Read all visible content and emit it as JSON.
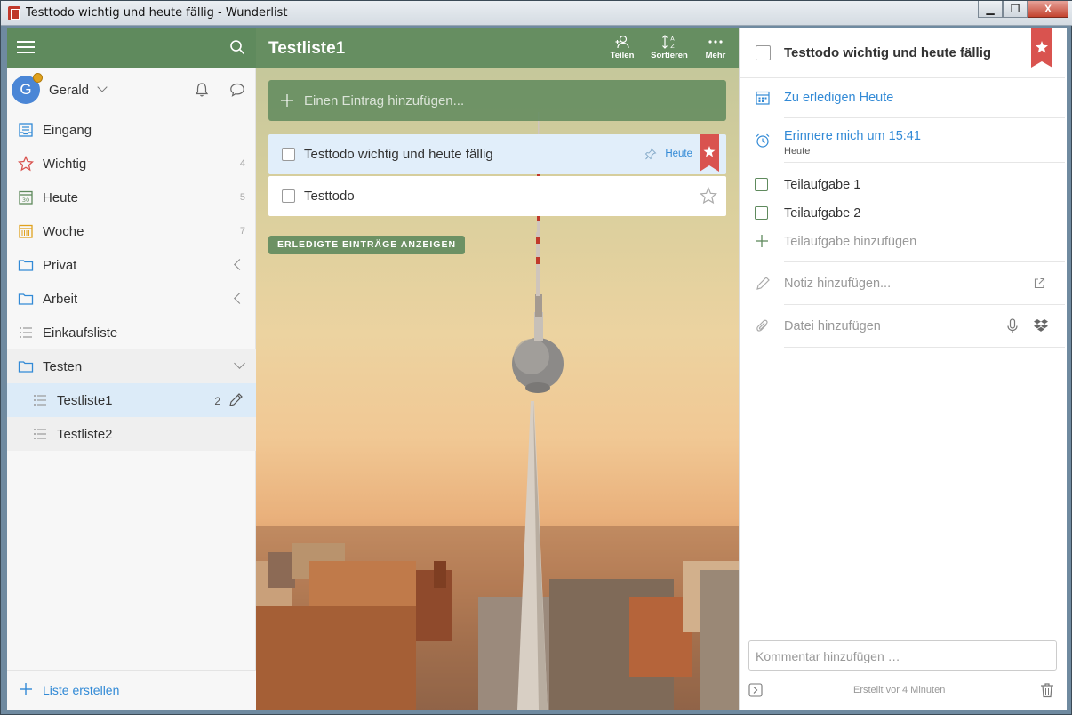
{
  "window": {
    "title": "Testtodo wichtig und heute fällig - Wunderlist",
    "minimize": "▁",
    "maximize": "❐",
    "close": "X"
  },
  "sidebar": {
    "user": {
      "initial": "G",
      "name": "Gerald"
    },
    "items": [
      {
        "label": "Eingang",
        "count": "",
        "icon": "inbox-icon"
      },
      {
        "label": "Wichtig",
        "count": "4",
        "icon": "star-icon"
      },
      {
        "label": "Heute",
        "count": "5",
        "icon": "calendar-today-icon"
      },
      {
        "label": "Woche",
        "count": "7",
        "icon": "calendar-week-icon"
      },
      {
        "label": "Privat",
        "count": "",
        "icon": "folder-icon"
      },
      {
        "label": "Arbeit",
        "count": "",
        "icon": "folder-icon"
      },
      {
        "label": "Einkaufsliste",
        "count": "",
        "icon": "list-icon"
      },
      {
        "label": "Testen",
        "count": "",
        "icon": "folder-icon"
      },
      {
        "label": "Testliste1",
        "count": "2",
        "icon": "list-icon"
      },
      {
        "label": "Testliste2",
        "count": "",
        "icon": "list-icon"
      }
    ],
    "create_list": "Liste erstellen"
  },
  "main": {
    "list_title": "Testliste1",
    "actions": {
      "share": "Teilen",
      "sort": "Sortieren",
      "more": "Mehr"
    },
    "add_placeholder": "Einen Eintrag hinzufügen...",
    "tasks": [
      {
        "text": "Testtodo wichtig und heute fällig",
        "due": "Heute",
        "starred": true
      },
      {
        "text": "Testtodo",
        "due": "",
        "starred": false
      }
    ],
    "show_completed": "ERLEDIGTE EINTRÄGE ANZEIGEN"
  },
  "detail": {
    "title": "Testtodo wichtig und heute fällig",
    "due": "Zu erledigen Heute",
    "reminder": "Erinnere mich um 15:41",
    "reminder_sub": "Heute",
    "subtasks": [
      "Teilaufgabe 1",
      "Teilaufgabe 2"
    ],
    "add_subtask": "Teilaufgabe hinzufügen",
    "note_placeholder": "Notiz hinzufügen...",
    "file_placeholder": "Datei hinzufügen",
    "comment_placeholder": "Kommentar hinzufügen …",
    "created": "Erstellt  vor 4 Minuten"
  },
  "colors": {
    "accent_green": "#5f8a5d",
    "link_blue": "#328ad6",
    "star_red": "#d9534f"
  }
}
